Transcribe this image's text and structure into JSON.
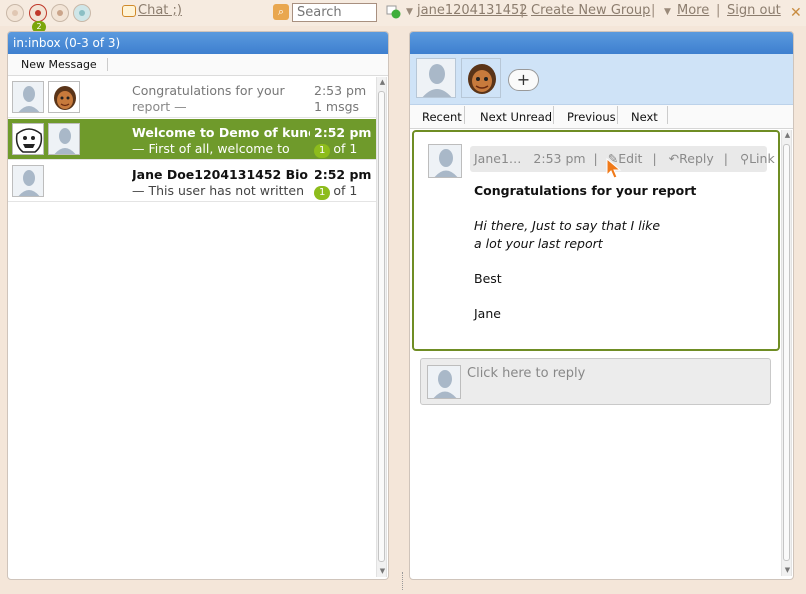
{
  "topbar": {
    "notification_count": "2",
    "chat_label": "Chat ;)",
    "search_placeholder": "Search",
    "username": "jane1204131452",
    "create_group": "Create New Group",
    "more": "More",
    "sign_out": "Sign out",
    "separator": "|"
  },
  "inbox": {
    "header": "in:inbox (0-3 of 3)",
    "new_message": "New Message",
    "rows": [
      {
        "title": "Congratulations for your",
        "snippet": "report —",
        "time": "2:53 pm",
        "count": "1 msgs",
        "unread": "",
        "of": ""
      },
      {
        "title": "Welcome to Demo of kune",
        "snippet": "— First of all, welcome to",
        "time": "2:52 pm",
        "count": "",
        "unread": "1",
        "of": "of 1"
      },
      {
        "title": "Jane Doe1204131452 Bio",
        "snippet": "— This user has not written",
        "time": "2:52 pm",
        "count": "",
        "unread": "1",
        "of": "of 1"
      }
    ]
  },
  "wave": {
    "add_participant": "+",
    "nav": {
      "recent": "Recent",
      "next_unread": "Next Unread",
      "previous": "Previous",
      "next": "Next"
    },
    "blip": {
      "author": "Jane1…",
      "time": "2:53 pm",
      "edit": "Edit",
      "reply": "Reply",
      "link": "Link",
      "separator": "|",
      "subject": "Congratulations for your report",
      "line1": "Hi there, Just to say that I like",
      "line2": "a lot your last report",
      "line3": "Best",
      "line4": "Jane"
    },
    "reply_placeholder": "Click here to reply"
  },
  "colors": {
    "header_blue": "#4a8bd6",
    "selected_green": "#6f9a2b",
    "badge_green": "#8dbc1c",
    "blip_border": "#6f8d24"
  }
}
